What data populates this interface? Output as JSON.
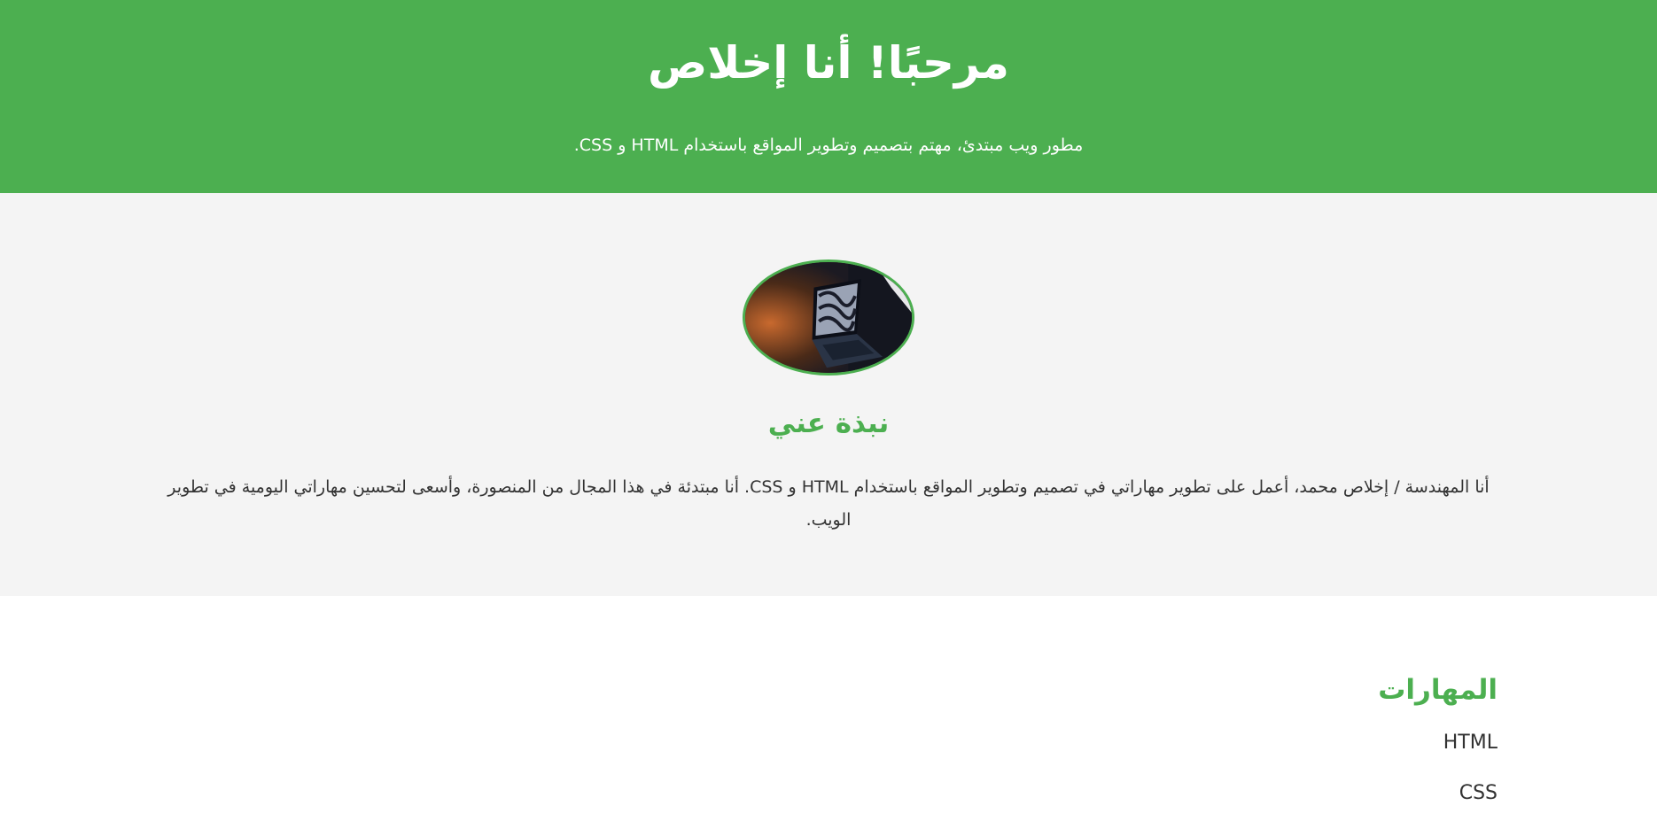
{
  "hero": {
    "title": "مرحبًا! أنا إخلاص",
    "subtitle": "مطور ويب مبتدئ، مهتم بتصميم وتطوير المواقع باستخدام HTML و CSS."
  },
  "about": {
    "photo_icon": "laptop-photo",
    "heading": "نبذة عني",
    "text": "أنا المهندسة / إخلاص محمد، أعمل على تطوير مهاراتي في تصميم وتطوير المواقع باستخدام HTML و CSS. أنا مبتدئة في هذا المجال من المنصورة، وأسعى لتحسين مهاراتي اليومية في تطوير الويب."
  },
  "skills": {
    "heading": "المهارات",
    "items": [
      "HTML",
      "CSS"
    ]
  },
  "colors": {
    "accent": "#4CAF50",
    "about_bg": "#f4f4f4",
    "text": "#333333"
  }
}
